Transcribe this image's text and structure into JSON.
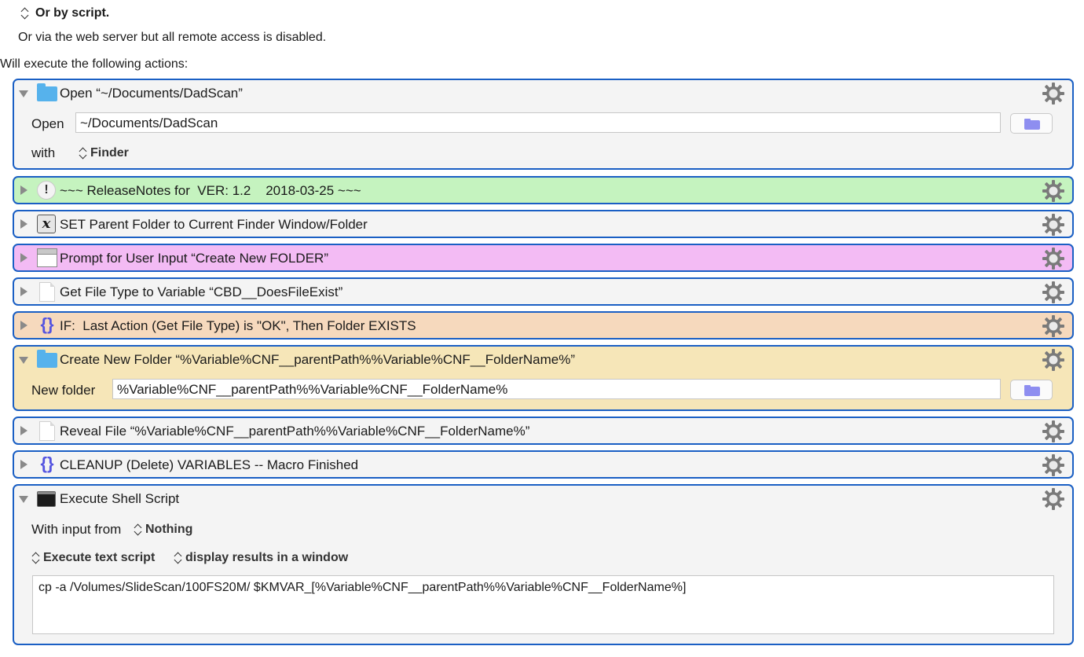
{
  "trigger": {
    "label": "Or by script."
  },
  "web_server_note": "Or via the web server but all remote access is disabled.",
  "actions_heading": "Will execute the following actions:",
  "actions": [
    {
      "title": "Open “~/Documents/DadScan”",
      "icon": "folder-icon",
      "expanded": true,
      "color": "#f4f4f4",
      "fields": {
        "open_label": "Open",
        "open_value": "~/Documents/DadScan",
        "with_label": "with",
        "with_app": "Finder"
      }
    },
    {
      "title": "~~~ ReleaseNotes for  VER: 1.2    2018-03-25 ~~~",
      "icon": "note-icon",
      "expanded": false,
      "color": "#c5f3bf"
    },
    {
      "title": "SET Parent Folder to Current Finder Window/Folder",
      "icon": "variable-icon",
      "expanded": false,
      "color": "#f4f4f4"
    },
    {
      "title": "Prompt for User Input “Create New FOLDER”",
      "icon": "prompt-window-icon",
      "expanded": false,
      "color": "#f3bbf4"
    },
    {
      "title": "Get File Type to Variable “CBD__DoesFileExist”",
      "icon": "document-icon",
      "expanded": false,
      "color": "#f4f4f4"
    },
    {
      "title": "IF:  Last Action (Get File Type) is \"OK\", Then Folder EXISTS",
      "icon": "braces-icon",
      "expanded": false,
      "color": "#f6d9bd"
    },
    {
      "title": "Create New Folder “%Variable%CNF__parentPath%%Variable%CNF__FolderName%”",
      "icon": "folder-icon",
      "expanded": true,
      "color": "#f6e6b8",
      "fields": {
        "new_folder_label": "New folder",
        "new_folder_value": "%Variable%CNF__parentPath%%Variable%CNF__FolderName%"
      }
    },
    {
      "title": "Reveal File “%Variable%CNF__parentPath%%Variable%CNF__FolderName%”",
      "icon": "document-icon",
      "expanded": false,
      "color": "#f4f4f4"
    },
    {
      "title": "CLEANUP (Delete) VARIABLES -- Macro Finished",
      "icon": "braces-icon",
      "expanded": false,
      "color": "#f4f4f4"
    },
    {
      "title": "Execute Shell Script",
      "icon": "terminal-icon",
      "expanded": true,
      "color": "#f4f4f4",
      "fields": {
        "input_label": "With input from",
        "input_value": "Nothing",
        "mode": "Execute text script",
        "output": "display results in a window",
        "script": "cp -a /Volumes/SlideScan/100FS20M/ $KMVAR_[%Variable%CNF__parentPath%%Variable%CNF__FolderName%]"
      }
    }
  ]
}
